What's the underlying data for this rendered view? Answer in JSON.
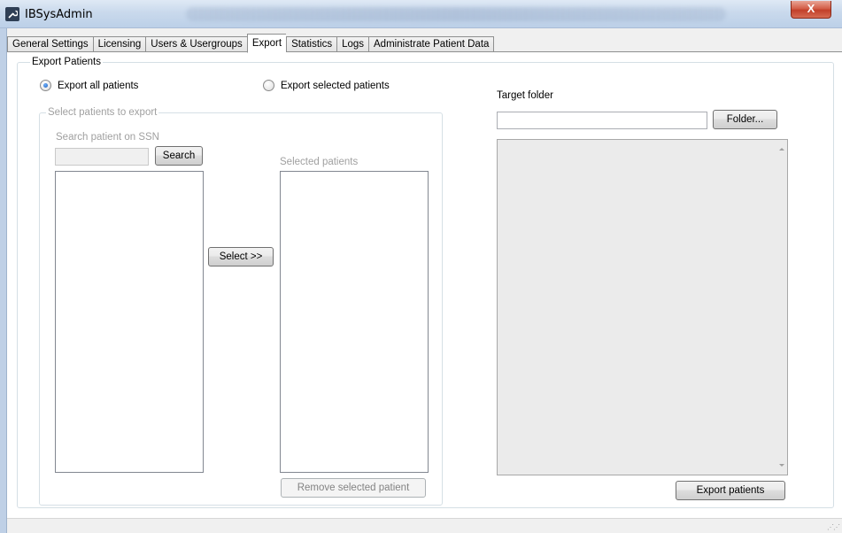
{
  "window": {
    "title": "IBSysAdmin",
    "close_label": "X"
  },
  "tabs": [
    {
      "label": "General Settings",
      "active": false
    },
    {
      "label": "Licensing",
      "active": false
    },
    {
      "label": "Users & Usergroups",
      "active": false
    },
    {
      "label": "Export",
      "active": true
    },
    {
      "label": "Statistics",
      "active": false
    },
    {
      "label": "Logs",
      "active": false
    },
    {
      "label": "Administrate Patient Data",
      "active": false
    }
  ],
  "export_panel": {
    "group_title": "Export Patients",
    "radio_all": {
      "label": "Export all patients",
      "checked": true
    },
    "radio_selected": {
      "label": "Export selected patients",
      "checked": false
    },
    "select_group": {
      "title": "Select patients to export",
      "search_label": "Search patient on SSN",
      "search_value": "",
      "search_button": "Search",
      "select_button": "Select >>",
      "selected_label": "Selected patients",
      "remove_button": "Remove selected patient"
    },
    "target": {
      "label": "Target folder",
      "value": "",
      "folder_button": "Folder..."
    },
    "export_button": "Export patients"
  }
}
